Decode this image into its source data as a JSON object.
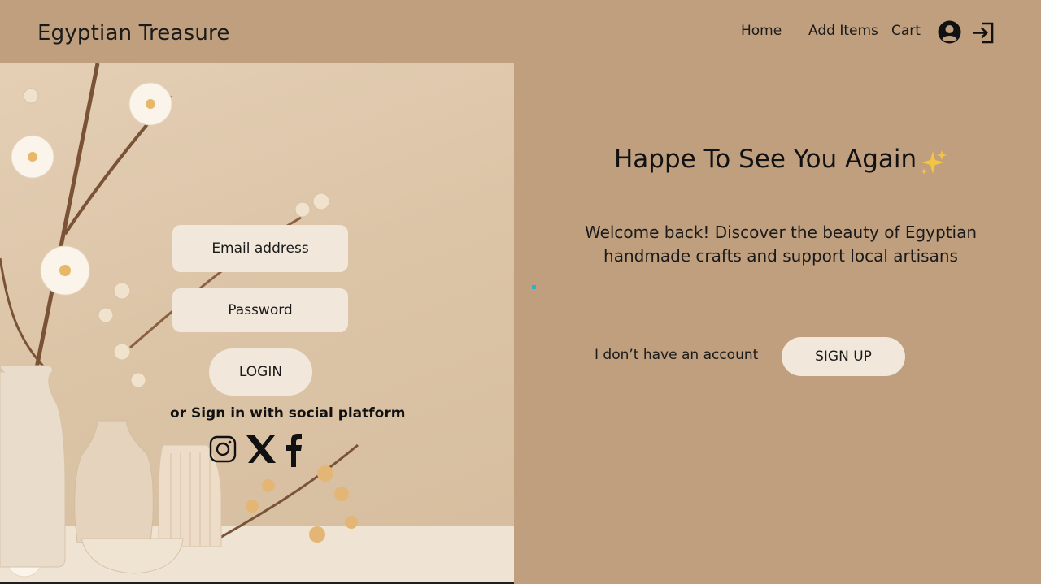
{
  "header": {
    "brand": "Egyptian Treasure",
    "nav": {
      "home": "Home",
      "add_items": "Add Items",
      "cart": "Cart"
    },
    "icons": [
      "user-icon",
      "logout-icon"
    ]
  },
  "login": {
    "email_placeholder": "Email address",
    "password_placeholder": "Password",
    "login_label": "LOGIN",
    "social_text": "or Sign in with social platform",
    "social_icons": [
      "instagram-icon",
      "x-icon",
      "facebook-icon"
    ]
  },
  "welcome": {
    "headline": "Happe To See You Again",
    "description": "Welcome back! Discover the beauty of Egyptian handmade crafts and support local artisans",
    "no_account": "I don’t have an account",
    "signup_label": "SIGN UP"
  },
  "colors": {
    "page_background": "#bf9f7d",
    "field_background": "#f1e8db",
    "sparkle": "#f4c542"
  }
}
